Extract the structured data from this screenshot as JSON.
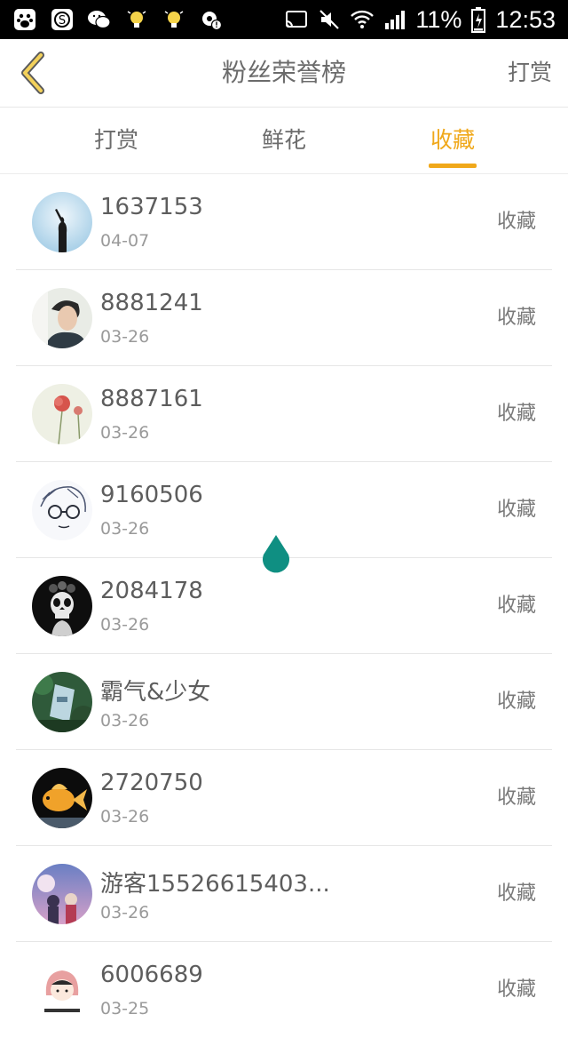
{
  "status_bar": {
    "battery": "11%",
    "time": "12:53",
    "left_icons": [
      "baidu-paw-icon",
      "s-app-icon",
      "wechat-icon",
      "lightbulb-icon",
      "lightbulb-icon",
      "settings-alert-icon"
    ],
    "right_icons": [
      "cast-icon",
      "mute-icon",
      "wifi-icon",
      "signal-icon",
      "battery-icon"
    ]
  },
  "header": {
    "title": "粉丝荣誉榜",
    "action_label": "打赏"
  },
  "tabs": [
    {
      "label": "打赏",
      "active": false
    },
    {
      "label": "鲜花",
      "active": false
    },
    {
      "label": "收藏",
      "active": true
    }
  ],
  "colors": {
    "accent": "#f0a81a",
    "text_primary": "#5d5d5d",
    "text_secondary": "#9a9a9a",
    "drop": "#0f8f82"
  },
  "fans": [
    {
      "name": "1637153",
      "date": "04-07",
      "tag": "收藏"
    },
    {
      "name": "8881241",
      "date": "03-26",
      "tag": "收藏"
    },
    {
      "name": "8887161",
      "date": "03-26",
      "tag": "收藏"
    },
    {
      "name": "9160506",
      "date": "03-26",
      "tag": "收藏"
    },
    {
      "name": "2084178",
      "date": "03-26",
      "tag": "收藏"
    },
    {
      "name": "霸气&少女",
      "date": "03-26",
      "tag": "收藏"
    },
    {
      "name": "2720750",
      "date": "03-26",
      "tag": "收藏"
    },
    {
      "name": "游客15526615403...",
      "date": "03-26",
      "tag": "收藏"
    },
    {
      "name": "6006689",
      "date": "03-25",
      "tag": "收藏"
    }
  ]
}
